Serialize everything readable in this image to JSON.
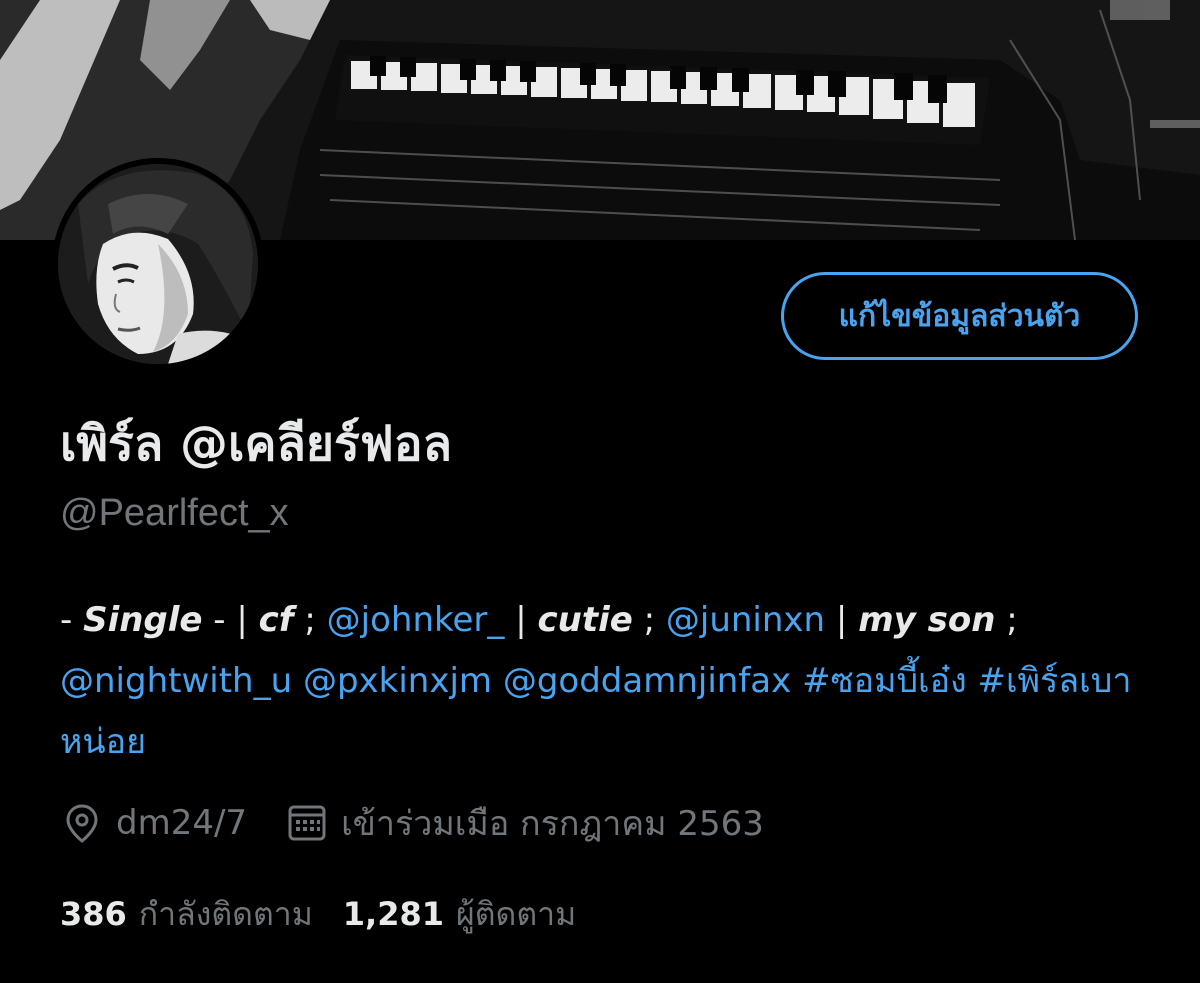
{
  "profile": {
    "display_name": "เพิร์ล @เคลียร์ฟอล",
    "handle": "@Pearlfect_x",
    "edit_button": "แก้ไขข้อมูลส่วนตัว",
    "bio": {
      "p1": "- ",
      "single": "Single",
      "p2": " - | ",
      "cf": "cf",
      "p3": " ; ",
      "m1": "@johnker_",
      "p4": " | ",
      "cutie": "cutie",
      "p5": " ; ",
      "m2": "@juninxn",
      "p6": " | ",
      "myson": "my son",
      "p7": " ; ",
      "m3": "@nightwith_u",
      "m4": "@pxkinxjm",
      "m5": "@goddamnjinfax",
      "h1": "#ซอมบี้เอ๋ง",
      "h2": "#เพิร์ลเบาหน่อย"
    },
    "location": "dm24/7",
    "joined": "เข้าร่วมเมือ กรกฎาคม 2563",
    "following_count": "386",
    "following_label": "กำลังติดตาม",
    "followers_count": "1,281",
    "followers_label": "ผู้ติดตาม"
  },
  "icons": {
    "location": "location-pin-icon",
    "calendar": "calendar-icon"
  },
  "colors": {
    "background": "#000000",
    "accent": "#4aa3ee",
    "primary_text": "#e7e9ea",
    "secondary_text": "#71767b"
  }
}
